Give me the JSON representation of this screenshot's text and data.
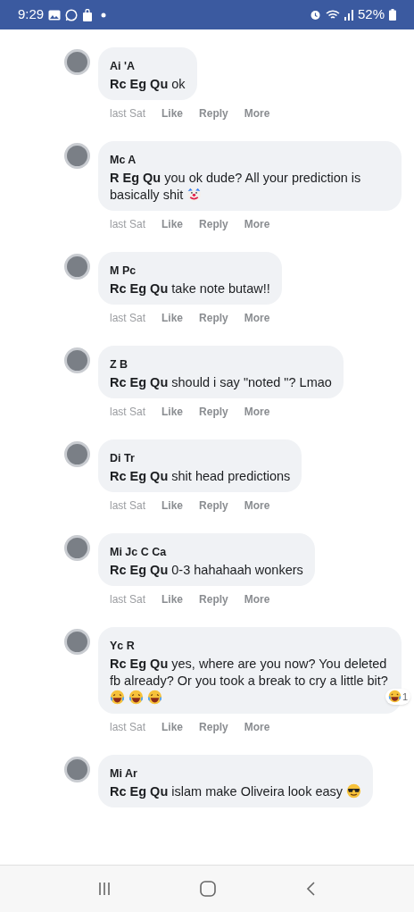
{
  "status_bar": {
    "time": "9:29",
    "battery": "52%"
  },
  "comments": [
    {
      "author": "Ai 'A",
      "mention": "Rc Eg Qu",
      "text": "ok",
      "time": "last Sat",
      "actions": [
        "Like",
        "Reply",
        "More"
      ]
    },
    {
      "author": "Mc A",
      "mention": "R Eg Qu",
      "text": "you ok dude? All your prediction is basically shit",
      "emojis": [
        {
          "kind": "clown"
        }
      ],
      "time": "last Sat",
      "actions": [
        "Like",
        "Reply",
        "More"
      ]
    },
    {
      "author": "M Pc",
      "mention": "Rc Eg Qu",
      "text": "take note butaw!!",
      "time": "last Sat",
      "actions": [
        "Like",
        "Reply",
        "More"
      ]
    },
    {
      "author": "Z B",
      "mention": "Rc Eg Qu",
      "text": "should i say \"noted \"? Lmao",
      "time": "last Sat",
      "actions": [
        "Like",
        "Reply",
        "More"
      ]
    },
    {
      "author": "Di Tr",
      "mention": "Rc Eg Qu",
      "text": "shit head predictions",
      "time": "last Sat",
      "actions": [
        "Like",
        "Reply",
        "More"
      ]
    },
    {
      "author": "Mi Jc C Ca",
      "mention": "Rc Eg Qu",
      "text": "0-3 hahahaah wonkers",
      "time": "last Sat",
      "actions": [
        "Like",
        "Reply",
        "More"
      ]
    },
    {
      "author": "Yc R",
      "mention": "Rc Eg Qu",
      "text": "yes, where are you now? You deleted fb already? Or you took a break to cry a little bit?",
      "emojis": [
        {
          "kind": "laughing"
        },
        {
          "kind": "laughing"
        },
        {
          "kind": "laughing"
        }
      ],
      "reaction": {
        "kind": "haha",
        "count": "1"
      },
      "time": "last Sat",
      "actions": [
        "Like",
        "Reply",
        "More"
      ]
    },
    {
      "author": "Mi Ar",
      "mention": "Rc Eg Qu",
      "text": "islam make Oliveira look easy",
      "emojis": [
        {
          "kind": "sunglasses"
        }
      ]
    }
  ]
}
